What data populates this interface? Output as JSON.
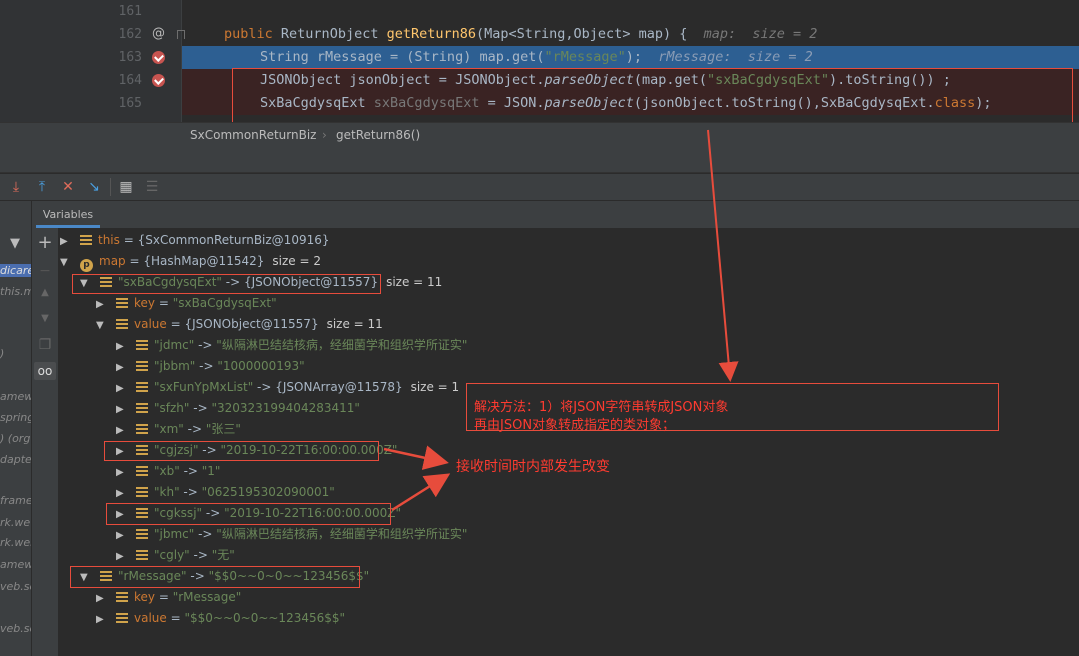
{
  "editor": {
    "lines": [
      {
        "num": "161"
      },
      {
        "num": "162",
        "gutter_icon": "at-icon",
        "tokens": {
          "kw": "public",
          "type": "ReturnObject",
          "fn": "getReturn86",
          "params": "(Map<String,Object> map) {",
          "hint": "map:  size = 2"
        }
      },
      {
        "num": "163",
        "gutter_icon": "breakpoint-icon",
        "tokens": {
          "a": "String rMessage = (String) map.get(",
          "s": "\"rMessage\"",
          "b": ");",
          "hint": "rMessage:  size = 2"
        }
      },
      {
        "num": "164",
        "gutter_icon": "breakpoint-icon",
        "tokens": {
          "a": "JSONObject jsonObject = JSONObject.",
          "m": "parseObject",
          "b": "(map.get(",
          "s": "\"sxBaCgdysqExt\"",
          "c": ").toString()) ;"
        }
      },
      {
        "num": "165",
        "tokens": {
          "a": "SxBaCgdysqExt ",
          "v": "sxBaCgdysqExt",
          "b": " = JSON.",
          "m": "parseObject",
          "c": "(jsonObject.toString(),SxBaCgdysqExt.",
          "k": "class",
          "d": ");"
        }
      }
    ],
    "breadcrumb": [
      "SxCommonReturnBiz",
      "getReturn86()"
    ]
  },
  "debugger": {
    "tab_label": "Variables",
    "frames_partial": [
      "dicare",
      "this.m",
      ")",
      "amew",
      "spring",
      ") (org",
      "dapte",
      "frame",
      "rk.we",
      "rk.web",
      "amew",
      "veb.se",
      "veb.se"
    ],
    "variables": [
      {
        "indent": 0,
        "arrow": "▶",
        "icon": "field-icon",
        "name": "this",
        "sep": " = ",
        "value": "{SxCommonReturnBiz@10916}",
        "value_kind": "ref"
      },
      {
        "indent": 0,
        "arrow": "▼",
        "icon": "param-icon",
        "icon_letter": "p",
        "name": "map",
        "sep": " = ",
        "value": "{HashMap@11542}",
        "value_kind": "ref",
        "size": "size = 2"
      },
      {
        "indent": 1,
        "arrow": "▼",
        "icon": "field-icon",
        "name": "\"sxBaCgdysqExt\"",
        "sep": " -> ",
        "value": "{JSONObject@11557}",
        "value_kind": "ref",
        "size": "size = 11",
        "name_kind": "str"
      },
      {
        "indent": 2,
        "arrow": "▶",
        "icon": "field-icon",
        "name": "key",
        "sep": " = ",
        "value": "\"sxBaCgdysqExt\"",
        "value_kind": "str"
      },
      {
        "indent": 2,
        "arrow": "▼",
        "icon": "field-icon",
        "name": "value",
        "sep": " = ",
        "value": "{JSONObject@11557}",
        "value_kind": "ref",
        "size": "size = 11"
      },
      {
        "indent": 3,
        "arrow": "▶",
        "icon": "field-icon",
        "name": "\"jdmc\"",
        "sep": " -> ",
        "value": "\"纵隔淋巴结结核病，经细菌学和组织学所证实\"",
        "value_kind": "str",
        "name_kind": "str"
      },
      {
        "indent": 3,
        "arrow": "▶",
        "icon": "field-icon",
        "name": "\"jbbm\"",
        "sep": " -> ",
        "value": "\"1000000193\"",
        "value_kind": "str",
        "name_kind": "str"
      },
      {
        "indent": 3,
        "arrow": "▶",
        "icon": "field-icon",
        "name": "\"sxFunYpMxList\"",
        "sep": " -> ",
        "value": "{JSONArray@11578}",
        "value_kind": "ref",
        "size": "size = 1",
        "name_kind": "str"
      },
      {
        "indent": 3,
        "arrow": "▶",
        "icon": "field-icon",
        "name": "\"sfzh\"",
        "sep": " -> ",
        "value": "\"320323199404283411\"",
        "value_kind": "str",
        "name_kind": "str"
      },
      {
        "indent": 3,
        "arrow": "▶",
        "icon": "field-icon",
        "name": "\"xm\"",
        "sep": " -> ",
        "value": "\"张三\"",
        "value_kind": "str",
        "name_kind": "str"
      },
      {
        "indent": 3,
        "arrow": "▶",
        "icon": "field-icon",
        "name": "\"cgjzsj\"",
        "sep": " -> ",
        "value": "\"2019-10-22T16:00:00.000Z\"",
        "value_kind": "str",
        "name_kind": "str"
      },
      {
        "indent": 3,
        "arrow": "▶",
        "icon": "field-icon",
        "name": "\"xb\"",
        "sep": " -> ",
        "value": "\"1\"",
        "value_kind": "str",
        "name_kind": "str"
      },
      {
        "indent": 3,
        "arrow": "▶",
        "icon": "field-icon",
        "name": "\"kh\"",
        "sep": " -> ",
        "value": "\"0625195302090001\"",
        "value_kind": "str",
        "name_kind": "str"
      },
      {
        "indent": 3,
        "arrow": "▶",
        "icon": "field-icon",
        "name": "\"cgkssj\"",
        "sep": " -> ",
        "value": "\"2019-10-22T16:00:00.000Z\"",
        "value_kind": "str",
        "name_kind": "str"
      },
      {
        "indent": 3,
        "arrow": "▶",
        "icon": "field-icon",
        "name": "\"jbmc\"",
        "sep": " -> ",
        "value": "\"纵隔淋巴结结核病，经细菌学和组织学所证实\"",
        "value_kind": "str",
        "name_kind": "str"
      },
      {
        "indent": 3,
        "arrow": "▶",
        "icon": "field-icon",
        "name": "\"cgly\"",
        "sep": " -> ",
        "value": "\"无\"",
        "value_kind": "str",
        "name_kind": "str"
      },
      {
        "indent": 1,
        "arrow": "▼",
        "icon": "field-icon",
        "name": "\"rMessage\"",
        "sep": " -> ",
        "value": "\"$$0~~0~0~~123456$$\"",
        "value_kind": "str",
        "name_kind": "str"
      },
      {
        "indent": 2,
        "arrow": "▶",
        "icon": "field-icon",
        "name": "key",
        "sep": " = ",
        "value": "\"rMessage\"",
        "value_kind": "str"
      },
      {
        "indent": 2,
        "arrow": "▶",
        "icon": "field-icon",
        "name": "value",
        "sep": " = ",
        "value": "\"$$0~~0~0~~123456$$\"",
        "value_kind": "str"
      }
    ]
  },
  "annotations": {
    "solution_line1": "解决方法：1）将JSON字符串转成JSON对象",
    "solution_line2": "再由JSON对象转成指定的类对象；",
    "time_changed": "接收时间时内部发生改变"
  },
  "colors": {
    "background": "#2b2b2b",
    "panel": "#3c3f41",
    "keyword": "#cc7832",
    "string": "#6a8759",
    "method": "#ffc66d",
    "selection": "#2d5f92",
    "breakpoint": "#c75450",
    "annotation": "#e74c3c"
  }
}
